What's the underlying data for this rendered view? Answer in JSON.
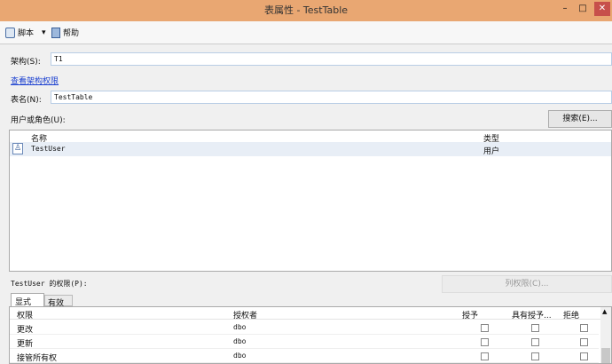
{
  "window": {
    "title": "表属性 - TestTable",
    "minimize": "–",
    "maximize": "□",
    "close": "✕"
  },
  "toolbar": {
    "script_label": "脚本",
    "help_label": "帮助",
    "dropdown": "▾"
  },
  "schema": {
    "label": "架构(S):",
    "value": "T1"
  },
  "view_schema_permissions": "查看架构权限",
  "table_name": {
    "label": "表名(N):",
    "value": "TestTable"
  },
  "users_label": "用户或角色(U):",
  "search_button": "搜索(E)...",
  "users_list": {
    "columns": [
      "名称",
      "类型"
    ],
    "rows": [
      {
        "name": "TestUser",
        "type": "用户"
      }
    ]
  },
  "permissions_label": "TestUser 的权限(P):",
  "column_permissions_button": "列权限(C)...",
  "tabs": [
    "显式",
    "有效"
  ],
  "perm_table": {
    "columns": [
      "权限",
      "授权者",
      "授予",
      "具有授予...",
      "拒绝"
    ],
    "rows": [
      {
        "permission": "更改",
        "grantor": "dbo"
      },
      {
        "permission": "更新",
        "grantor": "dbo"
      },
      {
        "permission": "接管所有权",
        "grantor": "dbo"
      }
    ]
  }
}
